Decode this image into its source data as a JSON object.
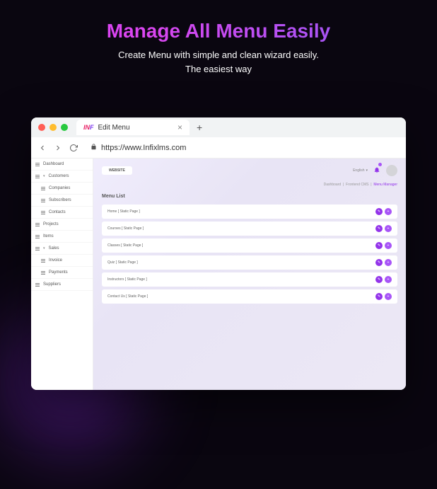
{
  "hero": {
    "title": "Manage All Menu Easily",
    "sub1": "Create Menu with simple and clean wizard easily.",
    "sub2": "The easiest way"
  },
  "browser": {
    "tab_title": "Edit Menu",
    "url": "https://www.Infixlms.com"
  },
  "sidebar": {
    "items": [
      {
        "label": "Dashboard",
        "sub": false,
        "expandable": false
      },
      {
        "label": "Customers",
        "sub": false,
        "expandable": true
      },
      {
        "label": "Companies",
        "sub": true,
        "expandable": false
      },
      {
        "label": "Subscribers",
        "sub": true,
        "expandable": false
      },
      {
        "label": "Contacts",
        "sub": true,
        "expandable": false
      },
      {
        "label": "Projects",
        "sub": false,
        "expandable": false
      },
      {
        "label": "Items",
        "sub": false,
        "expandable": false
      },
      {
        "label": "Sales",
        "sub": false,
        "expandable": true
      },
      {
        "label": "Invoice",
        "sub": true,
        "expandable": false
      },
      {
        "label": "Payments",
        "sub": true,
        "expandable": false
      },
      {
        "label": "Suppliers",
        "sub": false,
        "expandable": false
      }
    ]
  },
  "topbar": {
    "chip": "WEBSITE",
    "language": "English"
  },
  "breadcrumb": {
    "a": "Dashboard",
    "b": "Frontend CMS",
    "c": "Menu Manager"
  },
  "section_title": "Menu List",
  "menu_rows": [
    "Home [ Static Page ]",
    "Courses [ Static Page ]",
    "Classes [ Static Page ]",
    "Quiz [ Static Page ]",
    "Instructors [ Static Page ]",
    "Contact Us [ Static Page ]"
  ]
}
